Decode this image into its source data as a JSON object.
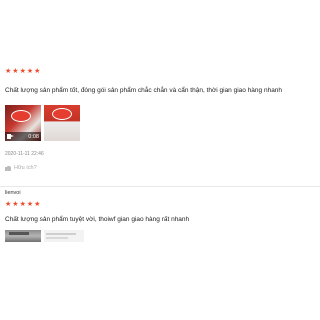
{
  "reviews": [
    {
      "rating": 5,
      "comment": "Chất lượng sản phẩm tốt, đóng gói sản phẩm chắc chắn và cẩn thận, thời gian giao hàng nhanh",
      "media": {
        "video_duration": "0:08"
      },
      "timestamp": "2020-11-11 22:46",
      "helpful_label": "Hữu ích?"
    },
    {
      "username": "lienvoi",
      "rating": 5,
      "comment": "Chất lượng sản phẩm tuyệt vời, thoiwf gian giao hàng rất nhanh"
    }
  ],
  "colors": {
    "star": "#ee4d2d",
    "divider": "#e8e8e8"
  },
  "icons": {
    "star": "star-icon",
    "video": "video-camera-icon",
    "helpful": "thumbs-up-icon"
  }
}
